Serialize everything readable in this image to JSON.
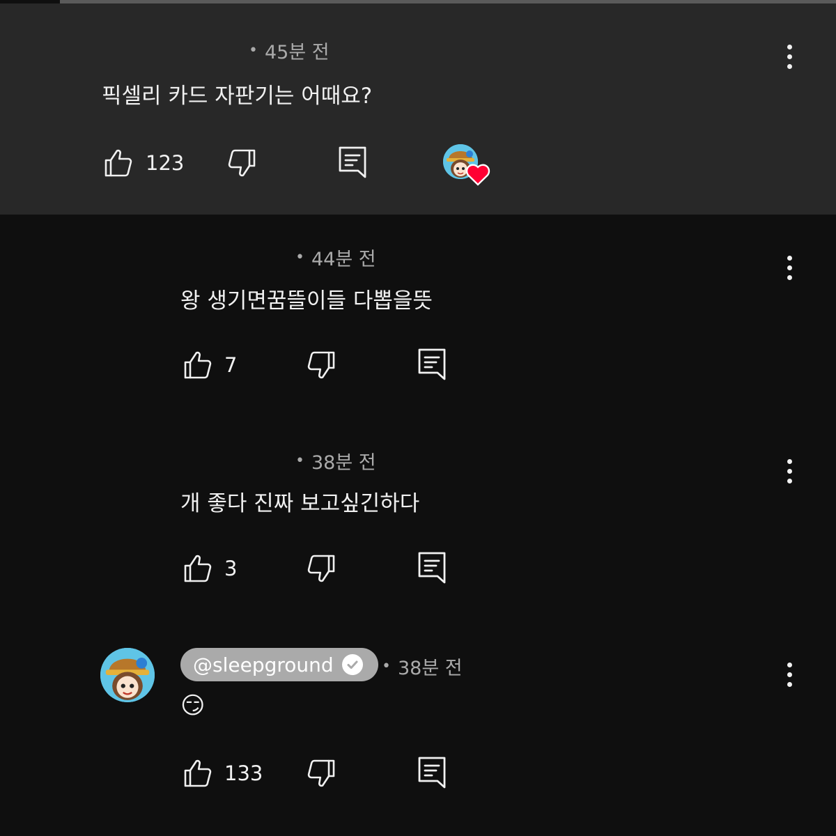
{
  "comments": [
    {
      "time": "45분 전",
      "text": "픽셀리 카드 자판기는 어때요?",
      "likes": "123",
      "creator_hearted": true
    },
    {
      "time": "44분 전",
      "text": "왕 생기면꿈뜰이들 다뽑을뜻",
      "likes": "7"
    },
    {
      "time": "38분 전",
      "text": "개 좋다 진짜 보고싶긴하다",
      "likes": "3"
    },
    {
      "author": "@sleepground",
      "time": "38분 전",
      "text": "😏",
      "likes": "133",
      "verified": true
    }
  ],
  "separator": "•",
  "icons": {
    "like": "thumb-up-icon",
    "dislike": "thumb-down-icon",
    "reply": "reply-icon",
    "more": "more-vertical-icon",
    "heart": "heart-icon",
    "verified": "checkmark-icon"
  },
  "colors": {
    "background": "#0f0f0f",
    "pinned_background": "#282828",
    "heart": "#ff0033",
    "chip": "#aaaaaa"
  }
}
